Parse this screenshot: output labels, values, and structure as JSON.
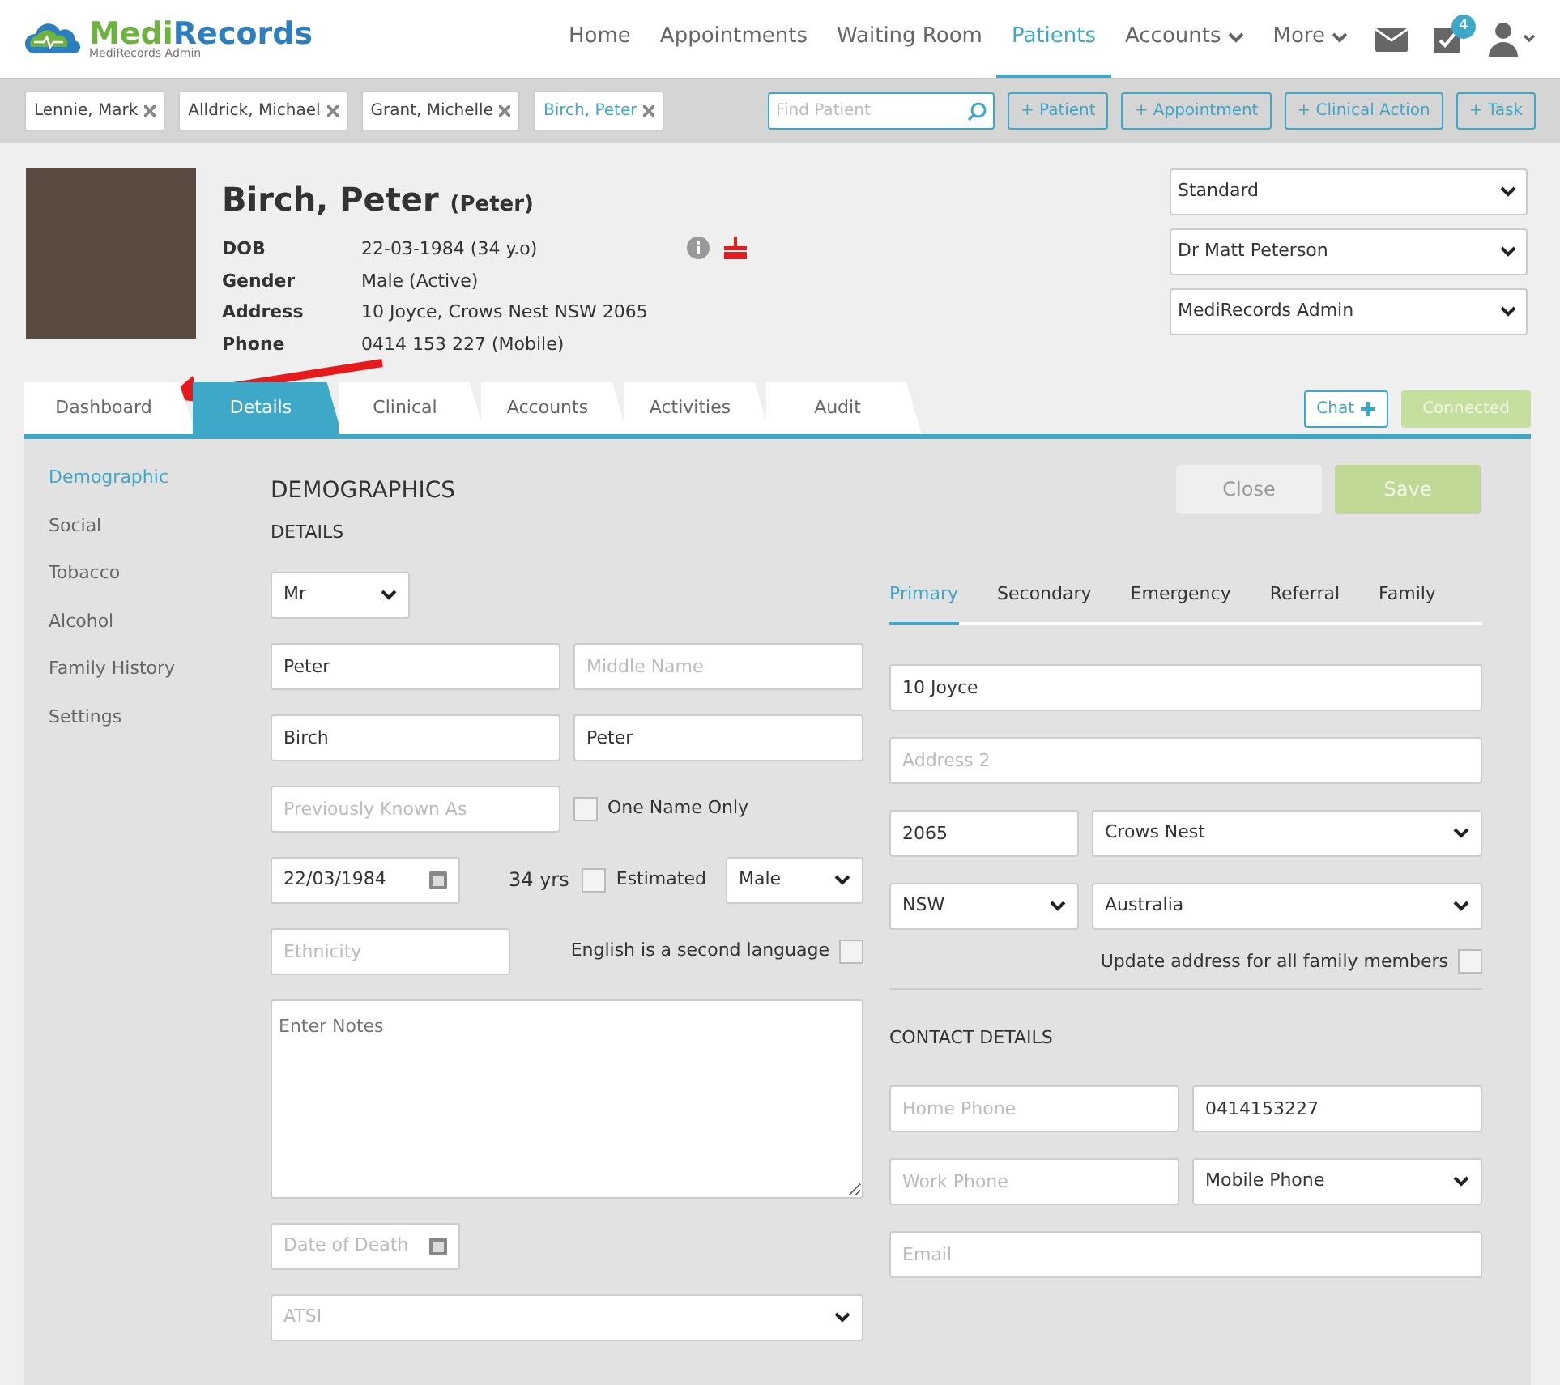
{
  "logo": {
    "name": "MediRecords",
    "subtitle": "MediRecords Admin"
  },
  "nav": [
    {
      "label": "Home",
      "selected": false,
      "dropdown": false
    },
    {
      "label": "Appointments",
      "selected": false,
      "dropdown": false
    },
    {
      "label": "Waiting Room",
      "selected": false,
      "dropdown": false
    },
    {
      "label": "Patients",
      "selected": true,
      "dropdown": false
    },
    {
      "label": "Accounts",
      "selected": false,
      "dropdown": true
    },
    {
      "label": "More",
      "selected": false,
      "dropdown": true
    }
  ],
  "tasks_badge": "4",
  "open_patients": [
    {
      "label": "Lennie, Mark",
      "selected": false
    },
    {
      "label": "Alldrick, Michael",
      "selected": false
    },
    {
      "label": "Grant, Michelle",
      "selected": false
    },
    {
      "label": "Birch, Peter",
      "selected": true
    }
  ],
  "find_patient": {
    "placeholder": "Find Patient"
  },
  "actions": [
    "+ Patient",
    "+ Appointment",
    "+ Clinical Action",
    "+ Task"
  ],
  "patient": {
    "name": "Birch, Peter",
    "preferred": "(Peter)",
    "facts": [
      {
        "label": "DOB",
        "value": "22-03-1984 (34 y.o)"
      },
      {
        "label": "Gender",
        "value": "Male (Active)"
      },
      {
        "label": "Address",
        "value": "10 Joyce, Crows Nest NSW 2065"
      },
      {
        "label": "Phone",
        "value": "0414 153 227 (Mobile)"
      }
    ]
  },
  "header_selects": [
    "Standard",
    "Dr Matt Peterson",
    "MediRecords Admin"
  ],
  "tabs": [
    {
      "label": "Dashboard",
      "selected": false
    },
    {
      "label": "Details",
      "selected": true
    },
    {
      "label": "Clinical",
      "selected": false
    },
    {
      "label": "Accounts",
      "selected": false
    },
    {
      "label": "Activities",
      "selected": false
    },
    {
      "label": "Audit",
      "selected": false
    }
  ],
  "chat_button": "Chat",
  "connection": "Connected",
  "side_menu": [
    {
      "label": "Demographic",
      "selected": true
    },
    {
      "label": "Social",
      "selected": false
    },
    {
      "label": "Tobacco",
      "selected": false
    },
    {
      "label": "Alcohol",
      "selected": false
    },
    {
      "label": "Family History",
      "selected": false
    },
    {
      "label": "Settings",
      "selected": false
    }
  ],
  "form": {
    "title": "DEMOGRAPHICS",
    "close": "Close",
    "save": "Save",
    "details_heading": "DETAILS",
    "title_select": {
      "value": "Mr"
    },
    "first_name": {
      "value": "Peter"
    },
    "middle_name": {
      "placeholder": "Middle Name"
    },
    "last_name": {
      "value": "Birch"
    },
    "preferred_name": {
      "value": "Peter"
    },
    "previous_name": {
      "placeholder": "Previously Known As"
    },
    "one_name_only": {
      "label": "One Name Only",
      "checked": false
    },
    "dob": {
      "value": "22/03/1984"
    },
    "age": "34 yrs",
    "estimated": {
      "label": "Estimated",
      "checked": false
    },
    "gender": {
      "value": "Male"
    },
    "ethnicity": {
      "placeholder": "Ethnicity"
    },
    "esl": {
      "label": "English is a second language",
      "checked": false
    },
    "notes": {
      "placeholder": "Enter Notes"
    },
    "date_of_death": {
      "placeholder": "Date of Death"
    },
    "atsi": {
      "placeholder": "ATSI"
    },
    "address_tabs": [
      {
        "label": "Primary",
        "selected": true
      },
      {
        "label": "Secondary",
        "selected": false
      },
      {
        "label": "Emergency",
        "selected": false
      },
      {
        "label": "Referral",
        "selected": false
      },
      {
        "label": "Family",
        "selected": false
      }
    ],
    "address1": {
      "value": "10 Joyce"
    },
    "address2": {
      "placeholder": "Address 2"
    },
    "postcode": {
      "value": "2065"
    },
    "suburb": {
      "value": "Crows Nest"
    },
    "state": {
      "value": "NSW"
    },
    "country": {
      "value": "Australia"
    },
    "update_family": {
      "label": "Update address for all family members",
      "checked": false
    },
    "contact_heading": "CONTACT DETAILS",
    "home_phone": {
      "placeholder": "Home Phone"
    },
    "mobile": {
      "value": "0414153227"
    },
    "work_phone": {
      "placeholder": "Work Phone"
    },
    "phone_type": {
      "value": "Mobile Phone"
    },
    "email": {
      "placeholder": "Email"
    }
  }
}
